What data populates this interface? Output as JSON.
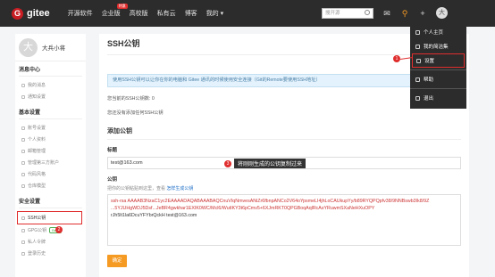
{
  "topbar": {
    "logo_letter": "G",
    "logo_text": "gitee",
    "nav": [
      "开源软件",
      "企业版",
      "高校版",
      "私有云",
      "博客",
      "我的 ▾"
    ],
    "nav_badge": "特惠",
    "search_placeholder": "搜开源",
    "avatar_letter": "大"
  },
  "sidebar": {
    "avatar_letter": "大",
    "username": "大兵小将",
    "groups": [
      {
        "title": "消息中心",
        "items": [
          "我的消息",
          "通知设置"
        ]
      },
      {
        "title": "基本设置",
        "items": [
          "账号设置",
          "个人资料",
          "邮箱管理",
          "管理第三方账户",
          "代码风格",
          "仓库模型"
        ]
      },
      {
        "title": "安全设置",
        "items": [
          "SSH公钥",
          "GPG公钥",
          "私人令牌",
          "登录历史"
        ]
      }
    ],
    "beta_label": "Beta"
  },
  "main": {
    "title": "SSH公钥",
    "notice": "使用SSH公钥可以让你在你的电脑和 Gitee 通讯的时候使用安全连接（Git的Remote要使用SSH地址）",
    "count": "您当前的SSH公钥数: 0",
    "none": "您还没有添加任何SSH公钥",
    "add_title": "添加公钥",
    "label_title": "标题",
    "title_value": "test@163.com",
    "label_key": "公钥",
    "key_help": "把你的公钥粘贴到这里，查看",
    "key_help_link": "怎样生成公钥",
    "key_start": "ssh-rsa AAAAB3NzaC1yc2EAAAADAQABAAABAQCnuVIqNmvesANiZr6fbnpANCo2V64oYpsmeLI4jhLoCAUkupYy/b89RYQPQpfv38/9NNBswb3Ik8/9Z",
    "key_mid": "...5YJUHgWDJ5Dsf...JeBR4gwkhar1EXIK0WC/Mcl6/WutIKY3t6pCmv5+6XJmRKT0QPGBoqAqlRcAsYRuwmSXaNeHXuOPY",
    "key_end": "rJh5lt1la6DcuYFYbrQckH test@163.com",
    "confirm": "确定"
  },
  "dropdown": {
    "items": [
      "个人主页",
      "我的简洁集",
      "设置",
      "帮助",
      "退出"
    ]
  },
  "annotations": {
    "badge1": "1",
    "badge2": "2",
    "badge3": "3",
    "callout": "将刚刚生成的公钥复制过来"
  }
}
